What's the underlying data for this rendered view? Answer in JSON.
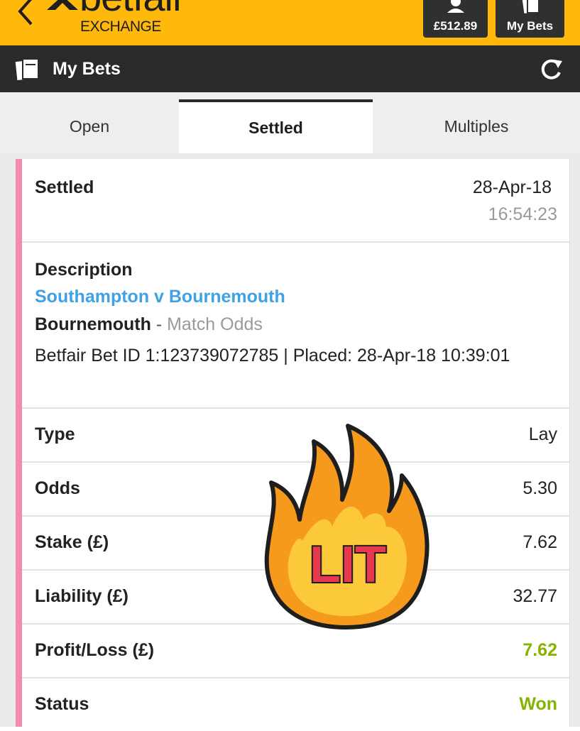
{
  "header": {
    "logo_word": "betfair",
    "logo_sub": "EXCHANGE",
    "balance": "£512.89",
    "my_bets_button": "My Bets"
  },
  "titlebar": {
    "title": "My Bets"
  },
  "tabs": [
    {
      "label": "Open",
      "active": false
    },
    {
      "label": "Settled",
      "active": true
    },
    {
      "label": "Multiples",
      "active": false
    }
  ],
  "bet": {
    "status_heading": "Settled",
    "date": "28-Apr-18",
    "time": "16:54:23",
    "description_label": "Description",
    "match": "Southampton v Bournemouth",
    "selection": "Bournemouth",
    "separator": " - ",
    "market": "Match Odds",
    "bet_id_line": "Betfair Bet ID 1:123739072785 | Placed: 28-Apr-18 10:39:01",
    "rows": {
      "type": {
        "label": "Type",
        "value": "Lay"
      },
      "odds": {
        "label": "Odds",
        "value": "5.30"
      },
      "stake": {
        "label": "Stake (£)",
        "value": "7.62"
      },
      "liability": {
        "label": "Liability (£)",
        "value": "32.77"
      },
      "profit_loss": {
        "label": "Profit/Loss (£)",
        "value": "7.62"
      },
      "status": {
        "label": "Status",
        "value": "Won"
      }
    }
  },
  "sticker": {
    "text": "LIT"
  },
  "colors": {
    "brand_yellow": "#ffb80c",
    "dark_bar": "#2a2a2a",
    "link_blue": "#3ea2e4",
    "win_green": "#86b300",
    "card_accent_pink": "#f08eac"
  }
}
